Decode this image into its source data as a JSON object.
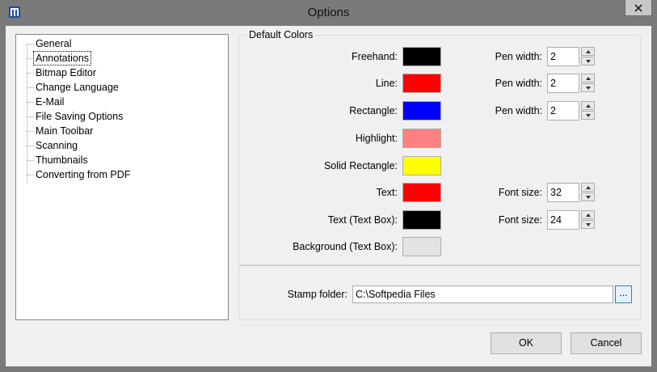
{
  "window": {
    "title": "Options"
  },
  "tree": {
    "items": [
      {
        "label": "General",
        "selected": false
      },
      {
        "label": "Annotations",
        "selected": true
      },
      {
        "label": "Bitmap Editor",
        "selected": false
      },
      {
        "label": "Change Language",
        "selected": false
      },
      {
        "label": "E-Mail",
        "selected": false
      },
      {
        "label": "File Saving Options",
        "selected": false
      },
      {
        "label": "Main Toolbar",
        "selected": false
      },
      {
        "label": "Scanning",
        "selected": false
      },
      {
        "label": "Thumbnails",
        "selected": false
      },
      {
        "label": "Converting from PDF",
        "selected": false
      }
    ]
  },
  "default_colors": {
    "group_title": "Default Colors",
    "rows": [
      {
        "label": "Freehand:",
        "color": "#000000",
        "option_label": "Pen width:",
        "option_value": "2"
      },
      {
        "label": "Line:",
        "color": "#ff0000",
        "option_label": "Pen width:",
        "option_value": "2"
      },
      {
        "label": "Rectangle:",
        "color": "#0000ff",
        "option_label": "Pen width:",
        "option_value": "2"
      },
      {
        "label": "Highlight:",
        "color": "#ff8080"
      },
      {
        "label": "Solid Rectangle:",
        "color": "#ffff00"
      },
      {
        "label": "Text:",
        "color": "#ff0000",
        "option_label": "Font size:",
        "option_value": "32"
      },
      {
        "label": "Text (Text Box):",
        "color": "#000000",
        "option_label": "Font size:",
        "option_value": "24"
      },
      {
        "label": "Background (Text Box):",
        "color": "#e3e3e3"
      }
    ]
  },
  "stamp": {
    "label": "Stamp folder:",
    "value": "C:\\Softpedia Files",
    "browse_label": "..."
  },
  "buttons": {
    "ok": "OK",
    "cancel": "Cancel"
  },
  "icons": {
    "app": "app-icon",
    "close": "close-icon",
    "spin_up": "spin-up-icon",
    "spin_down": "spin-down-icon"
  }
}
